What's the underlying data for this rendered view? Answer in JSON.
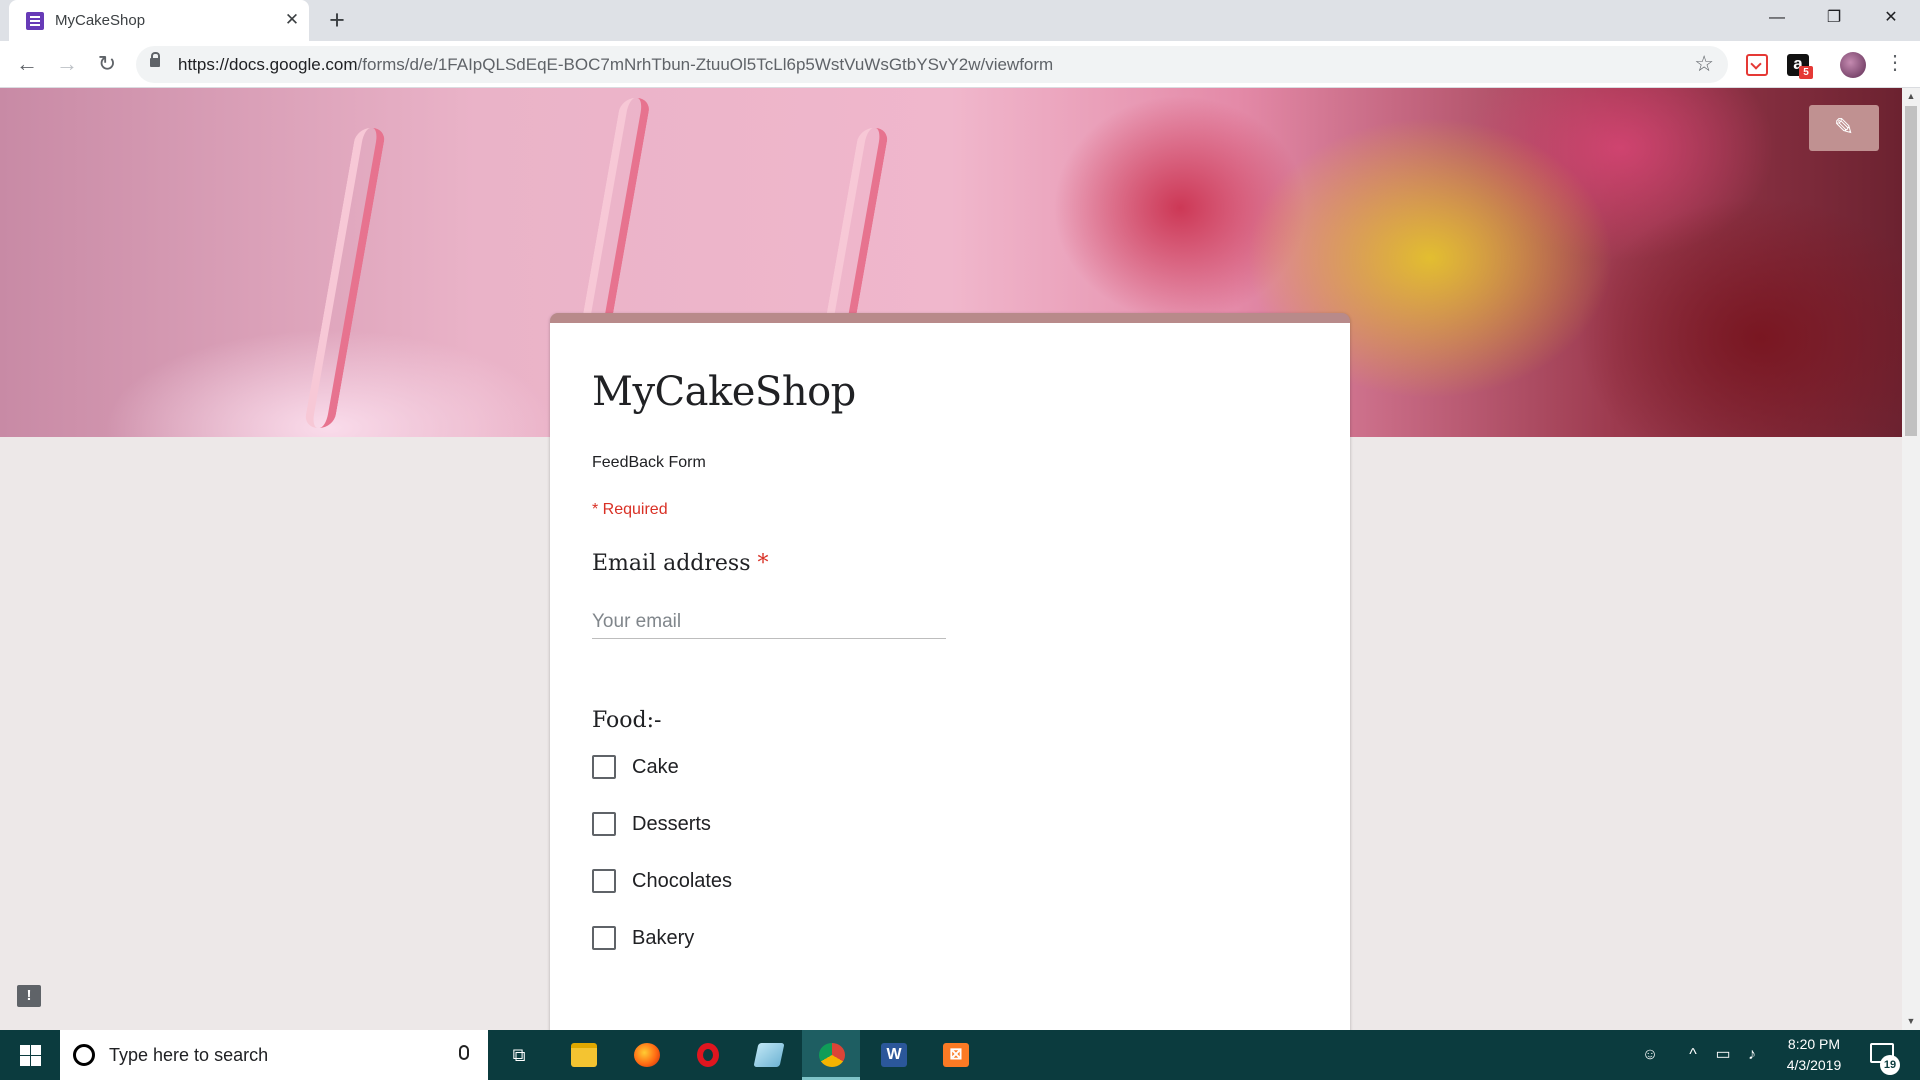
{
  "browser": {
    "tab_title": "MyCakeShop",
    "tab_close": "✕",
    "new_tab": "+",
    "url_host": "https://docs.google.com",
    "url_path": "/forms/d/e/1FAIpQLSdEqE-BOC7mNrhTbun-ZtuuOl5TcLl6p5WstVuWsGtbYSvY2w/viewform",
    "amazon_ext_letter": "a",
    "amazon_badge": "5",
    "window_controls": {
      "minimize": "—",
      "restore": "❐",
      "close": "✕"
    },
    "icons": [
      "back-icon",
      "forward-icon",
      "reload-icon",
      "lock-icon",
      "star-icon",
      "pocket-icon",
      "amazon-icon",
      "avatar",
      "menu-icon"
    ]
  },
  "form": {
    "title": "MyCakeShop",
    "description": "FeedBack Form",
    "required_note": "* Required",
    "edit_icon": "✎",
    "email_question": {
      "label": "Email address",
      "required_mark": "*",
      "placeholder": "Your email"
    },
    "food_question": {
      "label": "Food:-",
      "options": [
        "Cake",
        "Desserts",
        "Chocolates",
        "Bakery"
      ]
    },
    "feedback_icon": "!"
  },
  "taskbar": {
    "search_placeholder": "Type here to search",
    "apps": [
      "file-explorer-icon",
      "firefox-icon",
      "opera-icon",
      "notepad-icon",
      "chrome-icon",
      "word-icon",
      "xampp-icon"
    ],
    "active_app": "chrome-icon",
    "clock_time": "8:20 PM",
    "clock_date": "4/3/2019",
    "notification_count": "19"
  },
  "colors": {
    "form_accent": "#b88a8a",
    "required_red": "#d93025",
    "taskbar_bg": "#0b3b3e"
  }
}
